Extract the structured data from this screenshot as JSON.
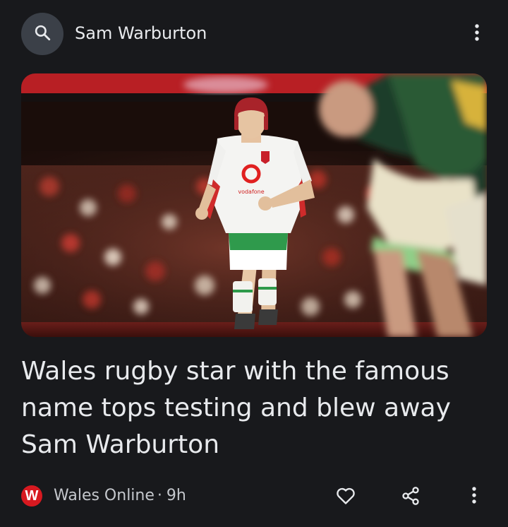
{
  "header": {
    "query": "Sam Warburton",
    "search_icon": "search-icon",
    "menu_icon": "more-vert-icon"
  },
  "article": {
    "image_icon": "article-photo",
    "headline": "Wales rugby star with the famous name tops testing and blew away Sam Warburton",
    "source": {
      "logo_letter": "W",
      "name": "Wales Online",
      "separator": "·",
      "age": "9h"
    },
    "actions": {
      "like_icon": "heart-icon",
      "share_icon": "share-icon",
      "more_icon": "more-vert-icon"
    }
  },
  "colors": {
    "background": "#18191c",
    "text": "#e8eaed",
    "source_logo": "#d71920",
    "search_circle": "#3b4048"
  }
}
